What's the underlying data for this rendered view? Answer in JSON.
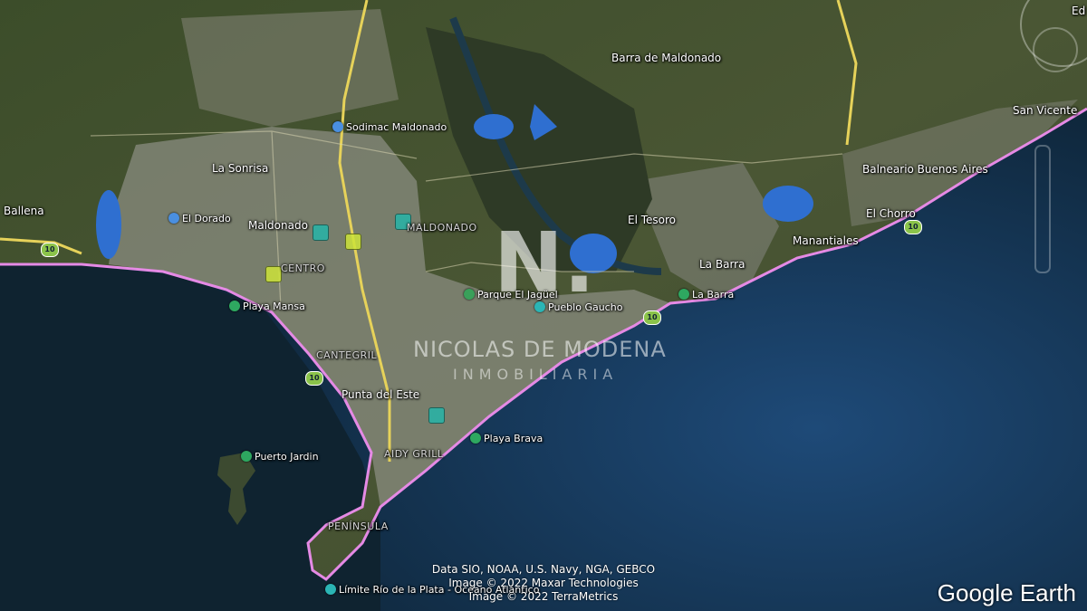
{
  "map": {
    "places": {
      "barra_de_maldonado": "Barra de Maldonado",
      "san_vicente": "San Vicente",
      "ed": "Ed",
      "la_sonrisa": "La Sonrisa",
      "balneario_buenos_aires": "Balneario Buenos Aires",
      "ballena": "Ballena",
      "el_tesoro": "El Tesoro",
      "el_chorro": "El Chorro",
      "maldonado": "Maldonado",
      "manantiales": "Manantiales",
      "la_barra": "La Barra",
      "punta_del_este": "Punta del Este"
    },
    "districts": {
      "maldonado_district": "MALDONADO",
      "centro": "CENTRO",
      "cantegril": "CANTEGRIL",
      "aidy_grill": "AIDY GRILL",
      "peninsula": "PENÍNSULA"
    },
    "pois": {
      "sodimac": "Sodimac Maldonado",
      "el_dorado": "El Dorado",
      "parque_el_jaguel": "Parque El Jagüel",
      "pueblo_gaucho": "Pueblo Gaucho",
      "la_barra_beach": "La Barra",
      "playa_mansa": "Playa Mansa",
      "playa_brava": "Playa Brava",
      "puerto_jardin": "Puerto Jardin",
      "limite": "Límite Río de la Plata - Océano Atlántico"
    },
    "route_number": "10"
  },
  "watermark": {
    "mark": "N.",
    "name": "NICOLAS DE MODENA",
    "sub": "INMOBILIARIA"
  },
  "attribution": {
    "line1": "Data SIO, NOAA, U.S. Navy, NGA, GEBCO",
    "line2": "Image © 2022 Maxar Technologies",
    "line3": "Image © 2022 TerraMetrics"
  },
  "brand": "Google Earth",
  "colors": {
    "land": "#3a4a2c",
    "urban": "#8a8c80",
    "ocean": "#0e2538",
    "coast_highlight": "#e58ae5",
    "road": "#e6d25a",
    "lagoon": "#2f6fd0"
  }
}
